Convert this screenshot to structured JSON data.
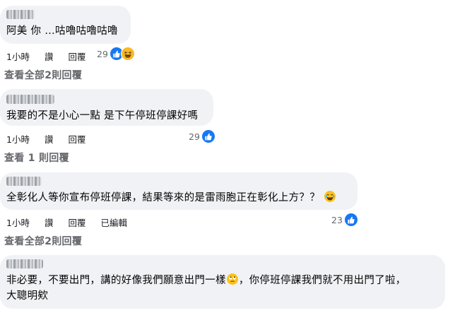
{
  "comments": [
    {
      "text": "阿美 你 …咕嚕咕嚕咕嚕",
      "actions": [
        "1小時",
        "讚",
        "回覆"
      ],
      "reaction_count": "29",
      "view_replies": "查看全部2則回覆"
    },
    {
      "text": "我要的不是小心一點 是下午停班停課好嗎",
      "actions": [
        "1小時",
        "讚",
        "回覆"
      ],
      "reaction_count": "29",
      "view_replies": "查看 1 則回覆"
    },
    {
      "text": "全彰化人等你宣布停班停課，結果等來的是雷雨胞正在彰化上方？？",
      "actions": [
        "1小時",
        "讚",
        "回覆",
        "已編輯"
      ],
      "reaction_count": "23",
      "view_replies": "查看全部2則回覆"
    },
    {
      "text_part1": "非必要，不要出門，講的好像我們願意出門一樣",
      "text_part2": "，你停班停課我們就不用出門了啦，",
      "text_line2": "大聰明欸"
    }
  ],
  "icons": {
    "like": "like-icon",
    "haha": "haha-icon",
    "rolling_eyes": "rolling-eyes-emoji"
  },
  "colors": {
    "bubble": "#f0f2f5",
    "like_blue": "#1877f2",
    "haha_yellow": "#f7b928",
    "secondary_text": "#65676b"
  }
}
